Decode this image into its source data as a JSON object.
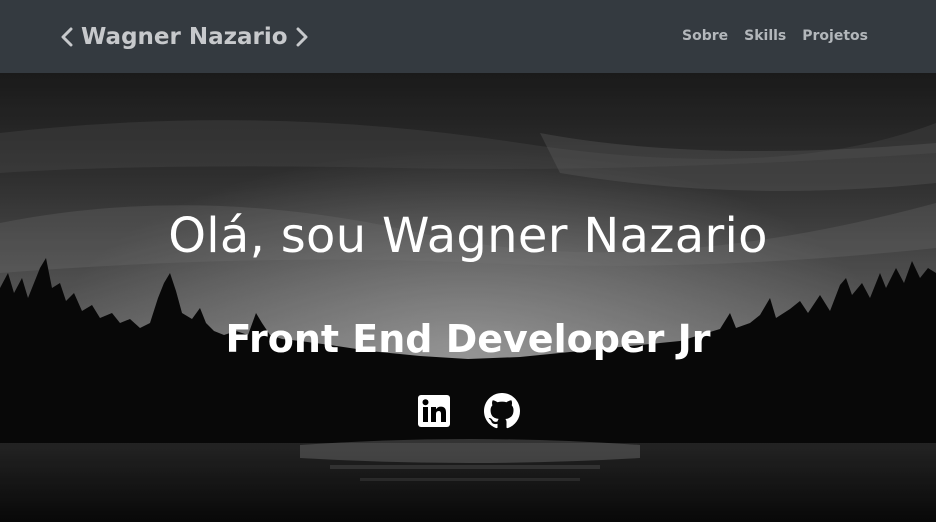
{
  "navbar": {
    "brand": "Wagner Nazario",
    "links": [
      {
        "label": "Sobre"
      },
      {
        "label": "Skills"
      },
      {
        "label": "Projetos"
      }
    ]
  },
  "hero": {
    "title": "Olá, sou Wagner Nazario",
    "subtitle": "Front End Developer Jr",
    "social_icons": [
      "linkedin-icon",
      "github-icon"
    ]
  },
  "colors": {
    "navbar_bg": "#343a40",
    "brand_text": "#c7c9cc",
    "nav_text": "#b3b7bb",
    "hero_text": "#ffffff"
  }
}
